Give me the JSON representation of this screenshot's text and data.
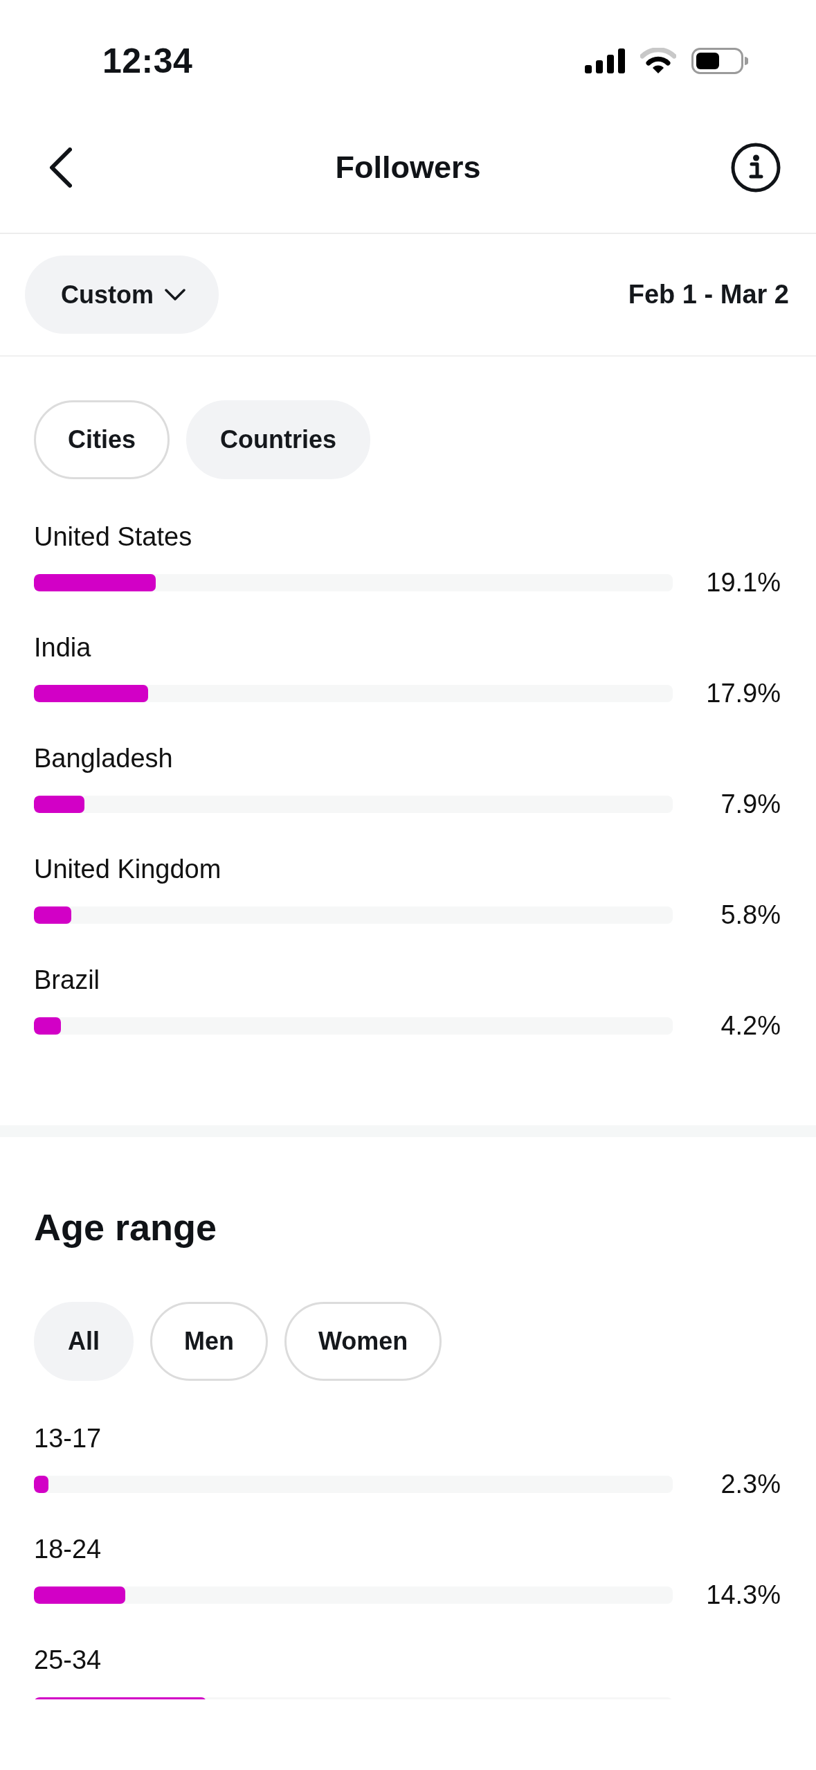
{
  "status_bar": {
    "time": "12:34"
  },
  "header": {
    "title": "Followers"
  },
  "filter": {
    "period": "Custom",
    "date_range": "Feb 1 - Mar 2"
  },
  "location": {
    "tabs": [
      {
        "label": "Cities",
        "selected": false
      },
      {
        "label": "Countries",
        "selected": true
      }
    ],
    "rows": [
      {
        "name": "United States",
        "level": 0.191,
        "value": "19.1%"
      },
      {
        "name": "India",
        "level": 0.179,
        "value": "17.9%"
      },
      {
        "name": "Bangladesh",
        "level": 0.079,
        "value": "7.9%"
      },
      {
        "name": "United Kingdom",
        "level": 0.058,
        "value": "5.8%"
      },
      {
        "name": "Brazil",
        "level": 0.042,
        "value": "4.2%"
      }
    ]
  },
  "age_range": {
    "title": "Age range",
    "tabs": [
      {
        "label": "All",
        "selected": true
      },
      {
        "label": "Men",
        "selected": false
      },
      {
        "label": "Women",
        "selected": false
      }
    ],
    "rows": [
      {
        "name": "13-17",
        "level": 0.023,
        "value": "2.3%"
      },
      {
        "name": "18-24",
        "level": 0.143,
        "value": "14.3%"
      },
      {
        "name": "25-34",
        "level": 0.27
      }
    ]
  }
}
